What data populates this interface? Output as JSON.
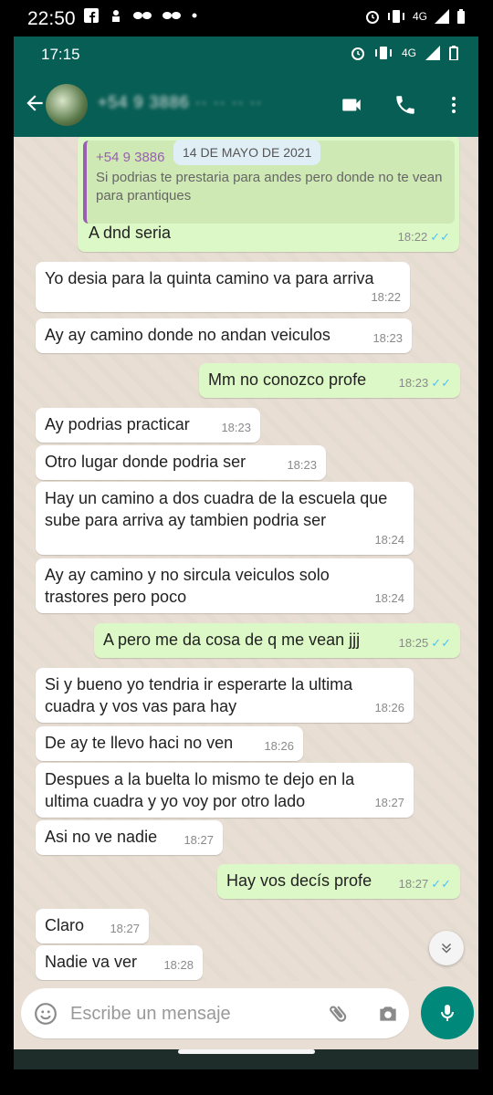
{
  "outer_status": {
    "time": "22:50",
    "network": "4G"
  },
  "inner_status": {
    "time": "17:15",
    "network": "4G"
  },
  "header": {
    "contact_name": "+54 9 3886 ·· ·· ·· ··"
  },
  "date_chip": "14 DE MAYO DE 2021",
  "quoted": {
    "sender": "+54 9 3886",
    "text": "Si podrias te prestaria para andes pero donde no te vean para prantiques"
  },
  "messages": [
    {
      "dir": "out",
      "text": "A dnd seria",
      "time": "18:22",
      "read": true
    },
    {
      "dir": "in",
      "text": "Yo desia para la quinta camino va para arriva",
      "time": "18:22"
    },
    {
      "dir": "in",
      "text": "Ay ay camino donde no andan veiculos",
      "time": "18:23"
    },
    {
      "dir": "out",
      "text": "Mm no conozco profe",
      "time": "18:23",
      "read": true
    },
    {
      "dir": "in",
      "text": "Ay podrias practicar",
      "time": "18:23"
    },
    {
      "dir": "in",
      "text": "Otro lugar donde podria ser",
      "time": "18:23"
    },
    {
      "dir": "in",
      "text": "Hay un camino a dos cuadra de la escuela que sube para arriva ay tambien podria ser",
      "time": "18:24"
    },
    {
      "dir": "in",
      "text": "Ay ay camino y no sircula veiculos solo trastores pero poco",
      "time": "18:24"
    },
    {
      "dir": "out",
      "text": "A pero me da cosa de q me vean jjj",
      "time": "18:25",
      "read": true
    },
    {
      "dir": "in",
      "text": "Si y bueno yo tendria ir esperarte la ultima cuadra y vos vas para hay",
      "time": "18:26"
    },
    {
      "dir": "in",
      "text": "De ay te llevo haci no ven",
      "time": "18:26"
    },
    {
      "dir": "in",
      "text": "Despues a la buelta lo mismo te dejo en la ultima cuadra y yo voy por otro lado",
      "time": "18:27"
    },
    {
      "dir": "in",
      "text": "Asi no ve nadie",
      "time": "18:27"
    },
    {
      "dir": "out",
      "text": "Hay vos decís profe",
      "time": "18:27",
      "read": true
    },
    {
      "dir": "in",
      "text": "Claro",
      "time": "18:27"
    },
    {
      "dir": "in",
      "text": "Nadie va ver",
      "time": "18:28"
    }
  ],
  "compose": {
    "placeholder": "Escribe un mensaje"
  },
  "icons": {
    "back": "arrow-left-icon",
    "video": "video-call-icon",
    "call": "phone-call-icon",
    "menu": "more-vert-icon",
    "emoji": "emoji-icon",
    "attach": "paperclip-icon",
    "camera": "camera-icon",
    "mic": "mic-icon",
    "scroll": "chevron-double-down-icon"
  },
  "colors": {
    "header": "#075e54",
    "outgoing": "#dcf8c6",
    "incoming": "#ffffff",
    "accent": "#00897b",
    "read_ticks": "#4fc3f7"
  }
}
